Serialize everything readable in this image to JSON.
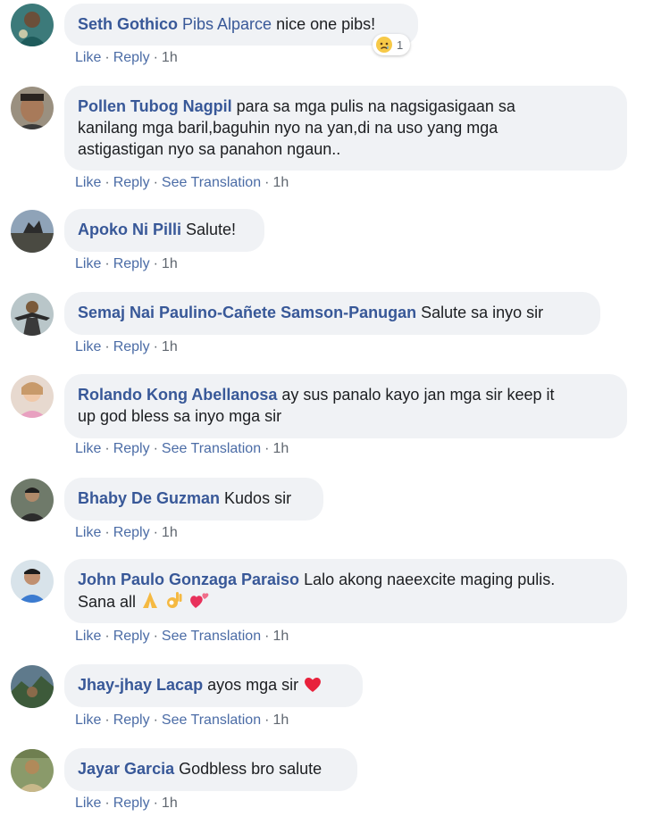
{
  "actions": {
    "like": "Like",
    "reply": "Reply",
    "see_translation": "See Translation",
    "sep": "·"
  },
  "colors": {
    "author": "#385898",
    "bubble": "#f0f2f5",
    "meta": "#606770"
  },
  "comments": [
    {
      "author": "Seth Gothico",
      "mention": "Pibs Alparce",
      "text": "nice one pibs!",
      "time": "1h",
      "reaction": {
        "icon": "sad-face-icon",
        "count": "1"
      }
    },
    {
      "author": "Pollen Tubog Nagpil",
      "line1": "para sa mga pulis na nagsigasigaan sa",
      "line2": "kanilang mga baril,baguhin nyo na yan,di na uso yang mga",
      "line3": "astigastigan nyo sa panahon ngaun..",
      "time": "1h"
    },
    {
      "author": "Apoko Ni Pilli",
      "text": "Salute!",
      "time": "1h"
    },
    {
      "author": "Semaj Nai Paulino-Cañete Samson-Panugan",
      "text": "Salute sa inyo sir",
      "time": "1h"
    },
    {
      "author": "Rolando Kong Abellanosa",
      "line1": "ay sus panalo kayo jan mga sir keep it",
      "line2": "up god bless sa inyo mga sir",
      "time": "1h"
    },
    {
      "author": "Bhaby De Guzman",
      "text": "Kudos sir",
      "time": "1h"
    },
    {
      "author": "John Paulo Gonzaga Paraiso",
      "line1": "Lalo akong naeexcite maging pulis.",
      "line2": "Sana all",
      "emojis": [
        "folded-hands-icon",
        "ok-hand-icon",
        "two-hearts-icon"
      ],
      "time": "1h"
    },
    {
      "author": "Jhay-jhay Lacap",
      "text": "ayos mga sir",
      "emojis": [
        "red-heart-icon"
      ],
      "time": "1h"
    },
    {
      "author": "Jayar Garcia",
      "text": "Godbless bro salute",
      "time": "1h"
    }
  ]
}
